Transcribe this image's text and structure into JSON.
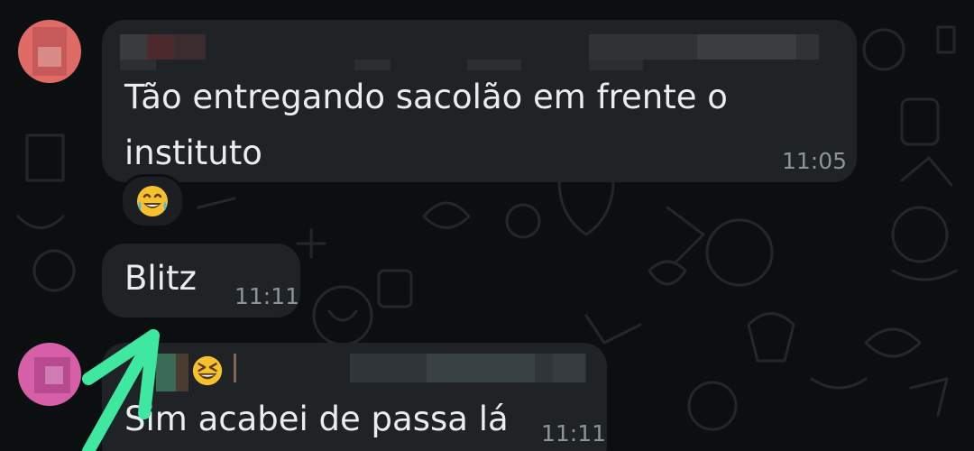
{
  "colors": {
    "background": "#0c0f10",
    "bubble": "#1f2326",
    "text": "#e9edef",
    "timestamp": "#8c9498",
    "arrow": "#3ee8a0"
  },
  "messages": [
    {
      "text_line1": "Tão entregando sacolão em frente o",
      "text_line2": "instituto",
      "time": "11:05",
      "reaction_icon": "face-with-tears-of-joy-emoji"
    },
    {
      "text": "Blitz",
      "time": "11:11"
    },
    {
      "text": "Sim acabei de passa lá",
      "time": "11:11",
      "sender_emoji_icon": "grinning-squinting-face-emoji"
    }
  ],
  "annotation": {
    "icon": "green-arrow-icon"
  }
}
